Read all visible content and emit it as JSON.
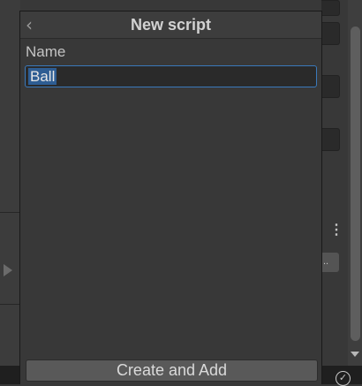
{
  "popup": {
    "title": "New script",
    "back_icon": "chevron-left-icon",
    "name_label": "Name",
    "name_value": "Ball",
    "create_button_label": "Create and Add"
  },
  "background": {
    "kebab_icon": "⋮",
    "ellipsis_button": "..",
    "status_icon": "check-circle-icon"
  },
  "colors": {
    "selection": "#2e5d93",
    "focus_border": "#3a79bb",
    "panel": "#383838"
  }
}
